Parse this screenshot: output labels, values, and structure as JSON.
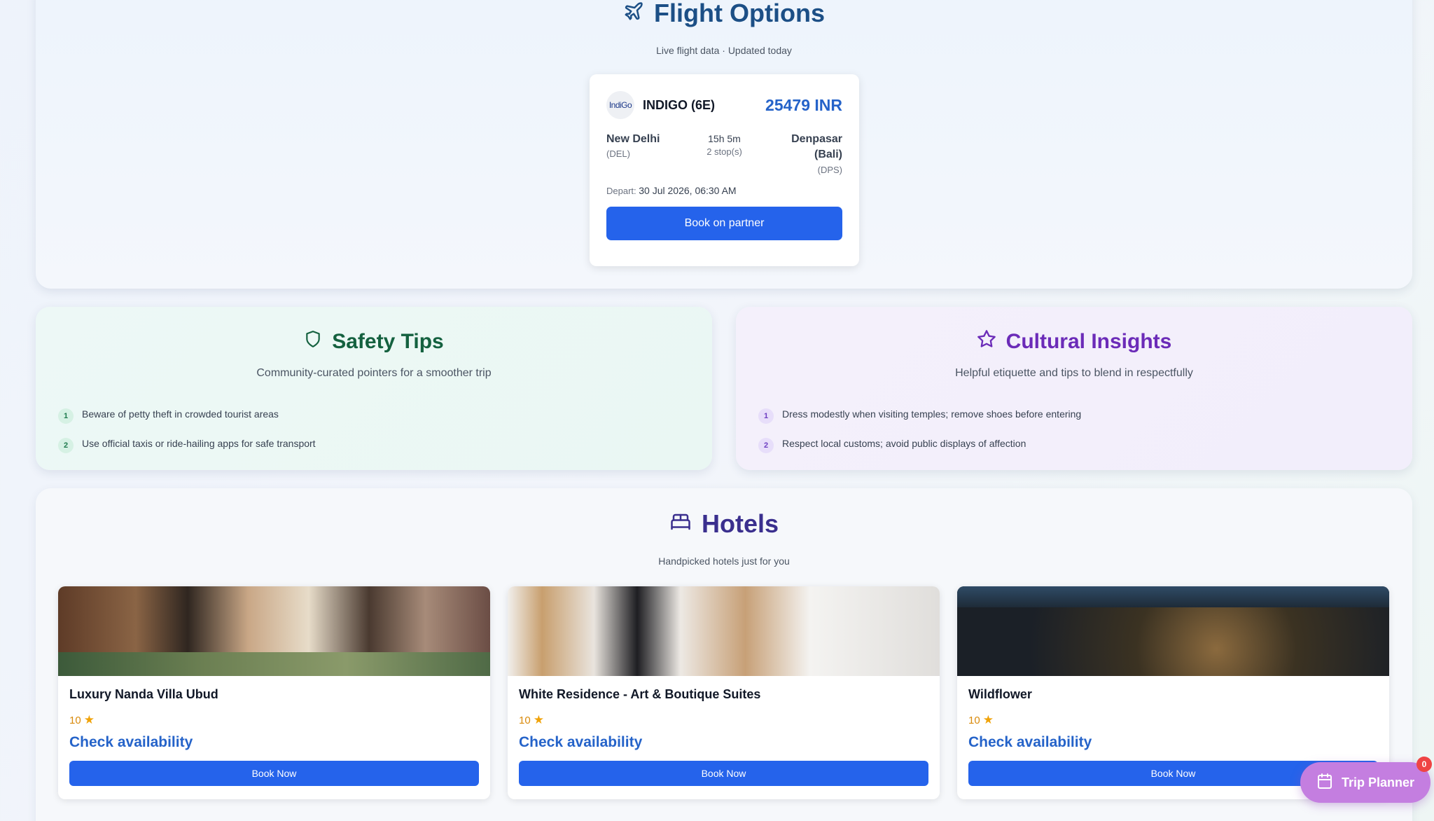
{
  "flights": {
    "title": "Flight Options",
    "subtitle": "Live flight data · Updated today",
    "card": {
      "logo_text": "IndiGo",
      "airline": "INDIGO (6E)",
      "price": "25479 INR",
      "from_city": "New Delhi",
      "from_code": "(DEL)",
      "duration": "15h 5m",
      "stops": "2 stop(s)",
      "to_city": "Denpasar (Bali)",
      "to_code": "(DPS)",
      "depart_label": "Depart:",
      "depart_value": "30 Jul 2026, 06:30 AM",
      "book_label": "Book on partner"
    }
  },
  "safety": {
    "title": "Safety Tips",
    "subtitle": "Community-curated pointers for a smoother trip",
    "items": [
      {
        "num": "1",
        "text": "Beware of petty theft in crowded tourist areas"
      },
      {
        "num": "2",
        "text": "Use official taxis or ride-hailing apps for safe transport"
      }
    ]
  },
  "cultural": {
    "title": "Cultural Insights",
    "subtitle": "Helpful etiquette and tips to blend in respectfully",
    "items": [
      {
        "num": "1",
        "text": "Dress modestly when visiting temples; remove shoes before entering"
      },
      {
        "num": "2",
        "text": "Respect local customs; avoid public displays of affection"
      }
    ]
  },
  "hotels": {
    "title": "Hotels",
    "subtitle": "Handpicked hotels just for you",
    "items": [
      {
        "name": "Luxury Nanda Villa Ubud",
        "rating": "10",
        "availability": "Check availability",
        "button": "Book Now"
      },
      {
        "name": "White Residence - Art & Boutique Suites",
        "rating": "10",
        "availability": "Check availability",
        "button": "Book Now"
      },
      {
        "name": "Wildflower",
        "rating": "10",
        "availability": "Check availability",
        "button": "Book Now"
      }
    ]
  },
  "trip_planner": {
    "label": "Trip Planner",
    "badge": "0"
  },
  "colors": {
    "primary_button": "#2563eb",
    "flight_title": "#1c4f86",
    "safety_title": "#14613f",
    "cultural_title": "#6b2bb8",
    "hotels_title": "#3a2f8e",
    "trip_planner": "#c47ee0"
  }
}
